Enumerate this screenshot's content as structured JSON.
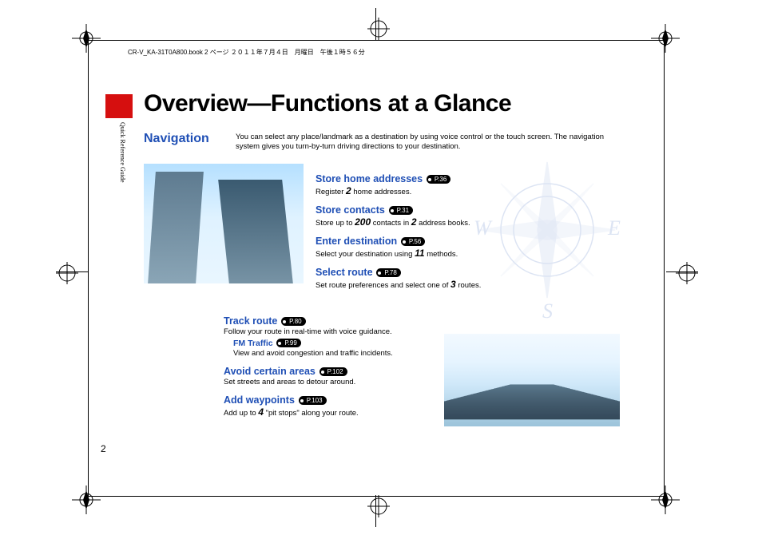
{
  "meta_header": "CR-V_KA-31T0A800.book  2 ページ  ２０１１年７月４日　月曜日　午後１時５６分",
  "side_tab": "Quick Reference Guide",
  "title": "Overview—Functions at a Glance",
  "section": "Navigation",
  "intro": "You can select any place/landmark as a destination by using voice control or the touch screen. The navigation system gives you turn-by-turn driving directions to your destination.",
  "right_block": [
    {
      "title": "Store home addresses",
      "page": "P.36",
      "desc_pre": "Register ",
      "num": "2",
      "desc_post": " home addresses."
    },
    {
      "title": "Store contacts",
      "page": "P.31",
      "desc_pre": "Store up to ",
      "num": "200",
      "desc_post": " contacts in ",
      "num2": "2",
      "desc_post2": " address books."
    },
    {
      "title": "Enter destination",
      "page": "P.56",
      "desc_pre": "Select your destination using ",
      "num": "11",
      "desc_post": " methods."
    },
    {
      "title": "Select route",
      "page": "P.78",
      "desc_pre": "Set route preferences and select one of ",
      "num": "3",
      "desc_post": " routes."
    }
  ],
  "lower_block": {
    "track": {
      "title": "Track route",
      "page": "P.80",
      "desc": "Follow your route in real-time with voice guidance."
    },
    "fm": {
      "title": "FM Traffic",
      "page": "P.99",
      "desc": "View and avoid congestion and traffic incidents."
    },
    "avoid": {
      "title": "Avoid certain areas",
      "page": "P.102",
      "desc": "Set streets and areas to detour around."
    },
    "waypoints": {
      "title": "Add waypoints",
      "page": "P.103",
      "desc_pre": "Add up to ",
      "num": "4",
      "desc_post": " \"pit stops\" along your route."
    }
  },
  "compass": {
    "n_implied": "",
    "w": "W",
    "e": "E",
    "s": "S"
  },
  "page_number": "2"
}
